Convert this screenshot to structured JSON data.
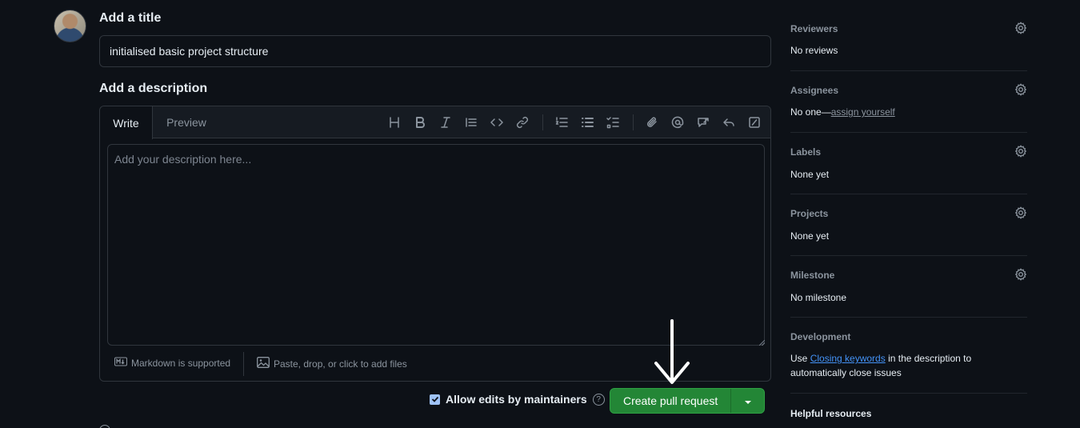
{
  "form": {
    "title_heading": "Add a title",
    "title_value": "initialised basic project structure",
    "description_heading": "Add a description",
    "tabs": [
      "Write",
      "Preview"
    ],
    "description_placeholder": "Add your description here...",
    "markdown_note": "Markdown is supported",
    "attach_note": "Paste, drop, or click to add files",
    "allow_edits_label": "Allow edits by maintainers",
    "allow_edits_checked": true,
    "help_glyph": "?",
    "submit_label": "Create pull request"
  },
  "toolbar_icons": [
    "heading-icon",
    "bold-icon",
    "italic-icon",
    "quote-icon",
    "code-icon",
    "link-icon",
    "ordered-list-icon",
    "unordered-list-icon",
    "task-list-icon",
    "attach-icon",
    "mention-icon",
    "reference-icon",
    "reply-icon",
    "slash-command-icon"
  ],
  "sidebar": {
    "reviewers": {
      "heading": "Reviewers",
      "value": "No reviews"
    },
    "assignees": {
      "heading": "Assignees",
      "value_prefix": "No one—",
      "value_link": "assign yourself"
    },
    "labels": {
      "heading": "Labels",
      "value": "None yet"
    },
    "projects": {
      "heading": "Projects",
      "value": "None yet"
    },
    "milestone": {
      "heading": "Milestone",
      "value": "No milestone"
    },
    "development": {
      "heading": "Development",
      "prefix": "Use ",
      "link": "Closing keywords",
      "suffix": " in the description to automatically close issues"
    },
    "helpful": {
      "heading": "Helpful resources"
    }
  },
  "colors": {
    "accent": "#238636",
    "link": "#4493f8",
    "bg": "#0d1117",
    "border": "#30363d"
  }
}
